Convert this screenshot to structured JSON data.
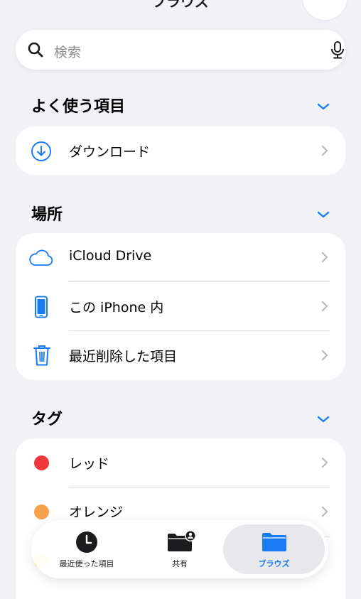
{
  "header": {
    "title": "ブラウズ"
  },
  "search": {
    "placeholder": "検索"
  },
  "sections": {
    "favorites": {
      "title": "よく使う項目",
      "items": [
        {
          "label": "ダウンロード",
          "icon": "download-circle-icon"
        }
      ]
    },
    "locations": {
      "title": "場所",
      "items": [
        {
          "label": "iCloud Drive",
          "icon": "cloud-icon"
        },
        {
          "label": "この iPhone 内",
          "icon": "iphone-icon"
        },
        {
          "label": "最近削除した項目",
          "icon": "trash-icon"
        }
      ]
    },
    "tags": {
      "title": "タグ",
      "items": [
        {
          "label": "レッド",
          "color": "#f2383c"
        },
        {
          "label": "オレンジ",
          "color": "#f5a04a"
        },
        {
          "label": "",
          "color": "#f7e35f"
        }
      ]
    }
  },
  "tabbar": {
    "tabs": [
      {
        "label": "最近使った項目",
        "icon": "clock-icon"
      },
      {
        "label": "共有",
        "icon": "shared-folder-icon"
      },
      {
        "label": "ブラウズ",
        "icon": "folder-icon",
        "active": true
      }
    ]
  },
  "colors": {
    "accent": "#1a7cf5",
    "background": "#f2f1f6",
    "card": "#ffffff"
  }
}
